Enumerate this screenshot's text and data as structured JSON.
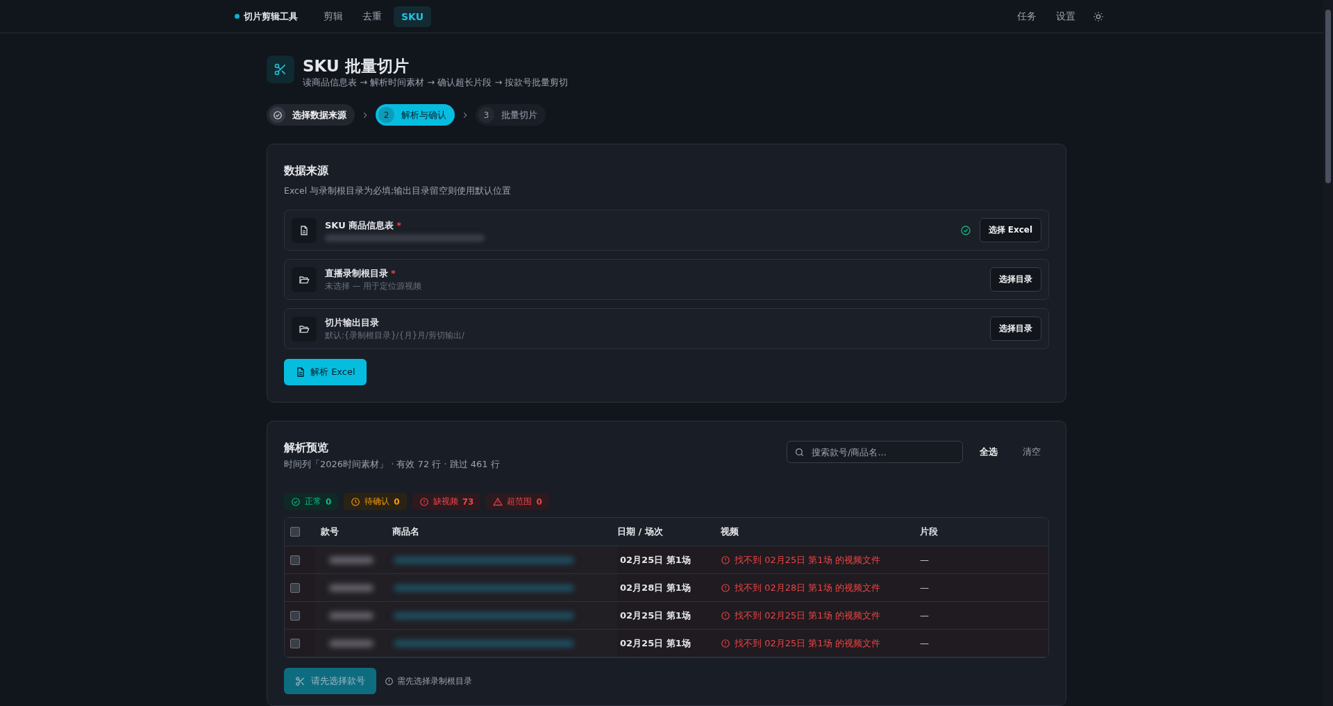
{
  "nav": {
    "brand": "切片剪辑工具",
    "tabs": [
      {
        "label": "剪辑",
        "selected": false
      },
      {
        "label": "去重",
        "selected": false
      },
      {
        "label": "SKU",
        "selected": true
      }
    ],
    "actions": [
      "任务",
      "设置"
    ]
  },
  "header": {
    "title": "SKU 批量切片",
    "subtitle": "读商品信息表 → 解析时间素材 → 确认超长片段 → 按款号批量剪切"
  },
  "steps": [
    {
      "label": "选择数据来源",
      "done": true,
      "selected": false
    },
    {
      "label": "解析与确认",
      "number": "2",
      "done": false,
      "selected": true
    },
    {
      "label": "批量切片",
      "number": "3",
      "done": false,
      "selected": false
    }
  ],
  "source": {
    "title": "数据来源",
    "description": "Excel 与录制根目录为必填;输出目录留空则使用默认位置",
    "fields": [
      {
        "kind": "file",
        "label": "SKU 商品信息表",
        "required_mark": "*",
        "value_blurred": true,
        "ok": true,
        "button": "选择 Excel"
      },
      {
        "kind": "folder",
        "label": "直播录制根目录",
        "required_mark": "*",
        "hint": "未选择 — 用于定位源视频",
        "ok": false,
        "button": "选择目录"
      },
      {
        "kind": "folder",
        "label": "切片输出目录",
        "hint": "默认:{录制根目录}/{月}月/剪切输出/",
        "ok": false,
        "button": "选择目录"
      }
    ],
    "parse_button": "解析 Excel"
  },
  "preview": {
    "title": "解析预览",
    "summary": "时间列「2026时间素材」 · 有效 72 行 · 跳过 461 行",
    "search": {
      "placeholder": "搜索款号/商品名..."
    },
    "select_all": "全选",
    "clear": "清空",
    "chips": [
      {
        "kind": "ok",
        "label": "正常",
        "count": "0",
        "color": "#10b981"
      },
      {
        "kind": "pending",
        "label": "待确认",
        "count": "0",
        "color": "#f59e0b"
      },
      {
        "kind": "missing",
        "label": "缺视频",
        "count": "73",
        "color": "#ef4444"
      },
      {
        "kind": "range",
        "label": "超范围",
        "count": "0",
        "color": "#ef4444"
      }
    ],
    "select_all_checked": false,
    "columns": [
      "款号",
      "商品名",
      "日期 / 场次",
      "视频",
      "片段"
    ],
    "rows": [
      {
        "checked": false,
        "date": "02月25日 第1场",
        "video": "找不到 02月25日 第1场 的视频文件",
        "segment": "—"
      },
      {
        "checked": false,
        "date": "02月28日 第1场",
        "video": "找不到 02月28日 第1场 的视频文件",
        "segment": "—"
      },
      {
        "checked": false,
        "date": "02月25日 第1场",
        "video": "找不到 02月25日 第1场 的视频文件",
        "segment": "—"
      },
      {
        "checked": false,
        "date": "02月25日 第1场",
        "video": "找不到 02月25日 第1场 的视频文件",
        "segment": "—"
      }
    ],
    "cut_button": {
      "label": "请先选择款号",
      "disabled": true
    },
    "cut_hint": "需先选择录制根目录"
  }
}
